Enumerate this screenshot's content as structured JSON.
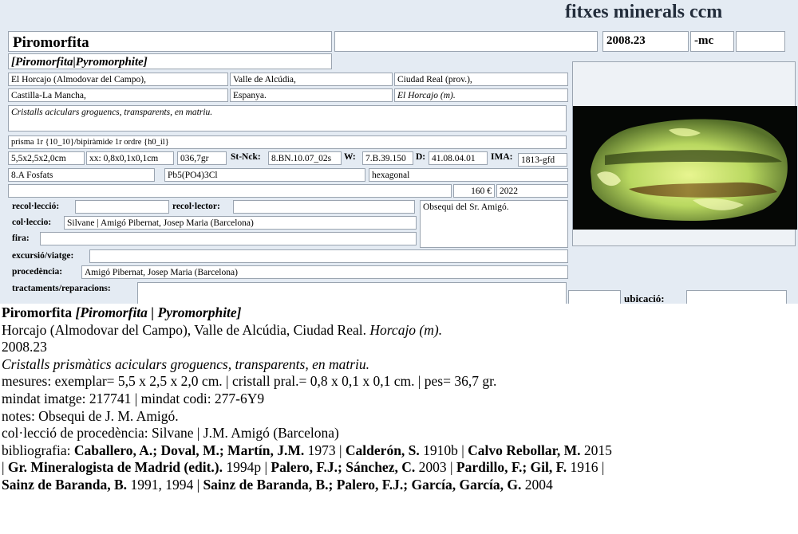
{
  "site_title": "fitxes minerals ccm",
  "card": {
    "name": "Piromorfita",
    "blank_top": "",
    "code": "2008.23",
    "suffix": "-mc",
    "blank_suffix": "",
    "synonym": "[Piromorfita|Pyromorphite]",
    "loc1": "El Horcajo (Almodovar del Campo),",
    "loc2": "Valle de Alcúdia,",
    "loc3": "Ciudad Real (prov.),",
    "loc4": "Castilla-La Mancha,",
    "loc5": "Espanya.",
    "loc6": "El Horcajo (m).",
    "description": "Cristalls aciculars groguencs, transparents, en matriu.",
    "forms": "prisma 1r {10_10}/bipiràmide 1r ordre {h0_il}",
    "size": "5,5x2,5x2,0cm",
    "crystal_size": "xx: 0,8x0,1x0,1cm",
    "weight": "036,7gr",
    "stnck_label": "St-Nck:",
    "stnck": "8.BN.10.07_02s",
    "w_label": "W:",
    "w": "7.B.39.150",
    "d_label": "D:",
    "d": "41.08.04.01",
    "ima_label": "IMA:",
    "ima": "1813-gfd",
    "class": "8.A Fosfats",
    "formula": "Pb5(PO4)3Cl",
    "system": "hexagonal",
    "price": "160 €",
    "year": "2022",
    "recoleccio_label": "recol·lecció:",
    "recoleccio": "",
    "recolector_label": "recol·lector:",
    "recolector": "",
    "notes": "Obsequi del Sr. Amigó.",
    "colleccio_label": "col·leccio:",
    "colleccio": "Silvane | Amigó Pibernat, Josep Maria (Barcelona)",
    "fira_label": "fira:",
    "fira": "",
    "excursio_label": "excursió/viatge:",
    "excursio": "",
    "procedencia_label": "procedència:",
    "procedencia": "Amigó Pibernat, Josep Maria (Barcelona)",
    "tractaments_label": "tractaments/reparacions:",
    "tractaments": "",
    "ubicacio_label": "ubicació:",
    "ubicacio": ""
  },
  "photo": {
    "icon": "mineral-photo",
    "bg_color": "#050705",
    "crystal_color": "#c8e070"
  },
  "info": {
    "name": "Piromorfita",
    "synonym": "[Piromorfita | Pyromorphite]",
    "locality": "Horcajo (Almodovar del Campo), Valle de Alcúdia, Ciudad Real.",
    "locality_mine": "Horcajo (m).",
    "code": "2008.23",
    "description": "Cristalls prismàtics aciculars groguencs, transparents, en matriu.",
    "measures": "mesures: exemplar= 5,5 x 2,5 x 2,0 cm. | cristall pral.= 0,8 x 0,1 x 0,1 cm. | pes= 36,7 gr.",
    "mindat": "mindat imatge: 217741 | mindat codi: 277-6Y9",
    "notes": "notes: Obsequi de J. M. Amigó.",
    "provenance": "col·lecció de procedència: Silvane | J.M. Amigó (Barcelona)",
    "biblio_label": "bibliografia:",
    "bib": [
      {
        "author": "Caballero, A.; Doval, M.; Martín, J.M.",
        "year": " 1973 | "
      },
      {
        "author": "Calderón, S.",
        "year": " 1910b | "
      },
      {
        "author": "Calvo Rebollar, M.",
        "year": " 2015"
      },
      {
        "lead": "| ",
        "author": "Gr. Mineralogista de Madrid (edit.).",
        "year": " 1994p | "
      },
      {
        "author": "Palero, F.J.; Sánchez, C.",
        "year": " 2003 | "
      },
      {
        "author": "Pardillo, F.; Gil, F.",
        "year": " 1916 |"
      },
      {
        "author": "Sainz de Baranda, B.",
        "year": " 1991, 1994 | "
      },
      {
        "author": "Sainz de Baranda, B.; Palero, F.J.; García, García, G.",
        "year": " 2004"
      }
    ]
  }
}
